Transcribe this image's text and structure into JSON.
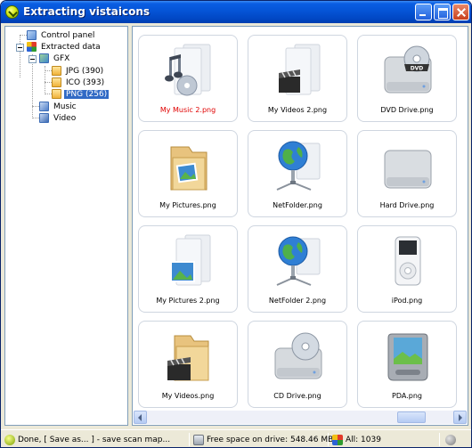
{
  "window": {
    "title": "Extracting vistaicons",
    "app_icon": "checkmark-ball-icon"
  },
  "title_buttons": [
    "minimize",
    "maximize",
    "close"
  ],
  "tree": [
    {
      "label": "Control panel",
      "icon": "control-panel-icon",
      "level": 1
    },
    {
      "label": "Extracted data",
      "icon": "extracted-data-icon",
      "level": 1,
      "expanded": true
    },
    {
      "label": "GFX",
      "icon": "gfx-icon",
      "level": 2,
      "expanded": true
    },
    {
      "label": "JPG (390)",
      "icon": "jpg-folder-icon",
      "level": 3
    },
    {
      "label": "ICO (393)",
      "icon": "ico-folder-icon",
      "level": 3
    },
    {
      "label": "PNG (256)",
      "icon": "png-folder-icon",
      "level": 3,
      "selected": true
    },
    {
      "label": "Music",
      "icon": "music-icon",
      "level": 2
    },
    {
      "label": "Video",
      "icon": "video-icon",
      "level": 2
    }
  ],
  "tiles": [
    {
      "caption": "My Music 2.png",
      "icon": "music-folder-icon",
      "highlight": true
    },
    {
      "caption": "My Videos 2.png",
      "icon": "videos-folder-icon"
    },
    {
      "caption": "DVD Drive.png",
      "icon": "dvd-drive-icon"
    },
    {
      "caption": "My Pictures.png",
      "icon": "pictures-folder-icon"
    },
    {
      "caption": "NetFolder.png",
      "icon": "network-globe-icon"
    },
    {
      "caption": "Hard Drive.png",
      "icon": "hard-drive-icon"
    },
    {
      "caption": "My Pictures 2.png",
      "icon": "pictures-folder-icon"
    },
    {
      "caption": "NetFolder 2.png",
      "icon": "network-globe-icon"
    },
    {
      "caption": "iPod.png",
      "icon": "ipod-icon"
    },
    {
      "caption": "My Videos.png",
      "icon": "videos-folder-icon"
    },
    {
      "caption": "CD Drive.png",
      "icon": "cd-drive-icon"
    },
    {
      "caption": "PDA.png",
      "icon": "pda-icon"
    }
  ],
  "statusbar": {
    "message": "Done, [ Save as... ] - save scan map...",
    "free_space": "Free space on drive: 548.46 MB",
    "all_count": "All: 1039"
  },
  "colors": {
    "accent_title": "#0554d6",
    "selection": "#316ac5",
    "highlight_caption": "#e00000"
  }
}
